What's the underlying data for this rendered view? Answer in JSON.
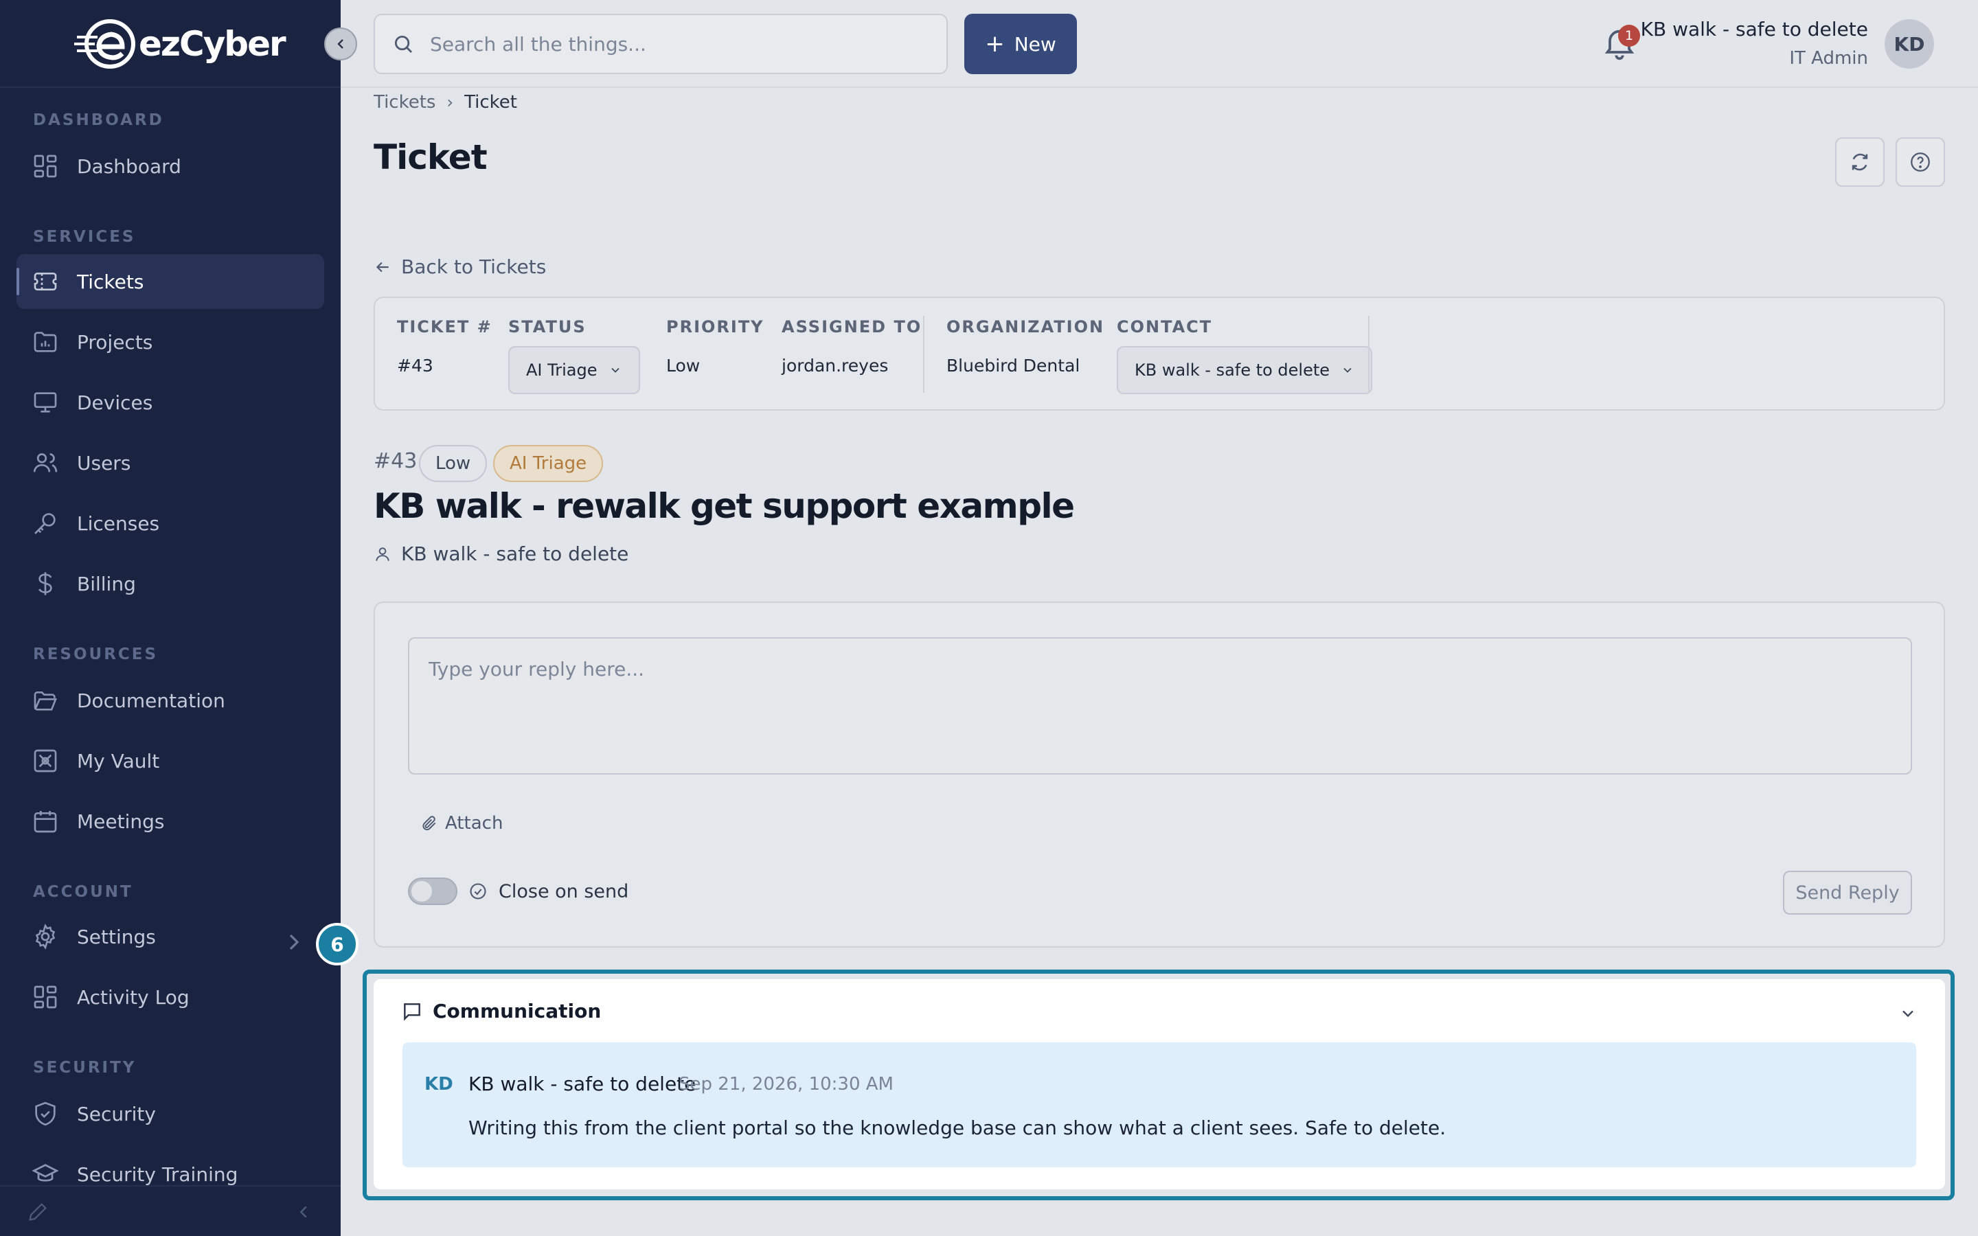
{
  "brand": {
    "name": "ezCyber"
  },
  "sidebar": {
    "sections": [
      {
        "label": "DASHBOARD"
      },
      {
        "label": "SERVICES"
      },
      {
        "label": "RESOURCES"
      },
      {
        "label": "ACCOUNT"
      },
      {
        "label": "SECURITY"
      }
    ],
    "items": [
      {
        "label": "Dashboard",
        "icon": "grid-icon"
      },
      {
        "label": "Tickets",
        "icon": "ticket-icon",
        "active": true
      },
      {
        "label": "Projects",
        "icon": "folder-chart-icon"
      },
      {
        "label": "Devices",
        "icon": "monitor-icon"
      },
      {
        "label": "Users",
        "icon": "users-icon"
      },
      {
        "label": "Licenses",
        "icon": "key-icon"
      },
      {
        "label": "Billing",
        "icon": "dollar-icon"
      },
      {
        "label": "Documentation",
        "icon": "folder-open-icon"
      },
      {
        "label": "My Vault",
        "icon": "vault-icon"
      },
      {
        "label": "Meetings",
        "icon": "calendar-icon"
      },
      {
        "label": "Settings",
        "icon": "gear-icon"
      },
      {
        "label": "Activity Log",
        "icon": "grid-icon"
      },
      {
        "label": "Security",
        "icon": "shield-icon"
      },
      {
        "label": "Security Training",
        "icon": "graduation-cap-icon"
      }
    ],
    "step_badge": "6"
  },
  "topbar": {
    "search_placeholder": "Search all the things...",
    "new_button": "New",
    "notification_count": "1",
    "user_name": "KB walk - safe to delete",
    "user_role": "IT Admin",
    "avatar_initials": "KD"
  },
  "breadcrumb": {
    "parent": "Tickets",
    "current": "Ticket"
  },
  "page": {
    "title": "Ticket",
    "back_link": "Back to Tickets"
  },
  "meta": {
    "ticket_label": "TICKET #",
    "ticket_value": "#43",
    "status_label": "STATUS",
    "status_value": "AI Triage",
    "priority_label": "PRIORITY",
    "priority_value": "Low",
    "assigned_label": "ASSIGNED TO",
    "assigned_value": "jordan.reyes",
    "org_label": "ORGANIZATION",
    "org_value": "Bluebird Dental",
    "contact_label": "CONTACT",
    "contact_value": "KB walk - safe to delete"
  },
  "ticket": {
    "number": "#43",
    "priority_badge": "Low",
    "status_badge": "AI Triage",
    "title": "KB walk - rewalk get support example",
    "contact": "KB walk - safe to delete"
  },
  "reply": {
    "placeholder": "Type your reply here...",
    "attach": "Attach",
    "close_on_send": "Close on send",
    "close_on_send_enabled": false,
    "send": "Send Reply"
  },
  "communication": {
    "title": "Communication",
    "messages": [
      {
        "initials": "KD",
        "author": "KB walk - safe to delete",
        "time": "Sep 21, 2026, 10:30 AM",
        "body": "Writing this from the client portal so the knowledge base can show what a client sees. Safe to delete."
      }
    ]
  },
  "colors": {
    "sidebar_bg": "#1a2340",
    "primary_button": "#354a7b",
    "highlight": "#1a7fa0",
    "ai_triage": "#b27a3a",
    "message_bg": "#dfeefb"
  }
}
